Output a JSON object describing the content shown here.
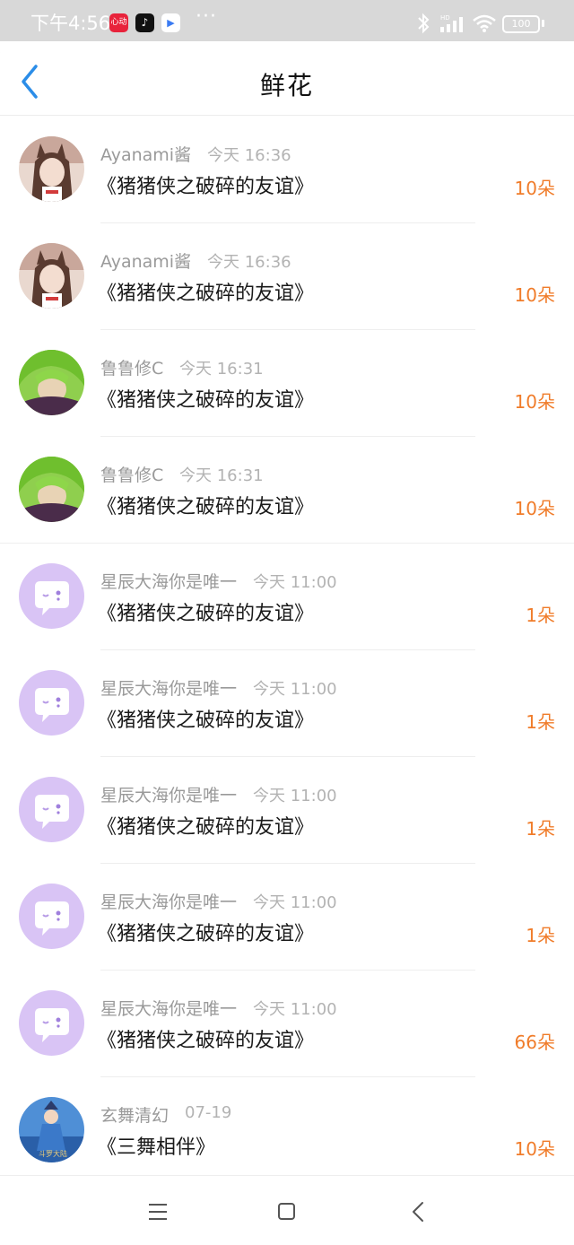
{
  "status_bar": {
    "time": "下午4:56",
    "apps": [
      {
        "icon": "red-app-icon",
        "label": "心动",
        "color": "#e8233b"
      },
      {
        "icon": "tiktok-icon",
        "label": "♪",
        "color": "#111111"
      },
      {
        "icon": "play-store-icon",
        "label": "▶",
        "color": "#ffffff"
      }
    ],
    "more": "···",
    "battery": "100"
  },
  "header": {
    "title": "鲜花",
    "back_icon": "chevron-left-icon",
    "accent_color": "#2b8de8"
  },
  "list": [
    {
      "user": "Ayanami酱",
      "time": "今天 16:36",
      "work": "《猪猪侠之破碎的友谊》",
      "count": "10朵",
      "avatar": "anime-girl-avatar"
    },
    {
      "user": "Ayanami酱",
      "time": "今天 16:36",
      "work": "《猪猪侠之破碎的友谊》",
      "count": "10朵",
      "avatar": "anime-girl-avatar"
    },
    {
      "user": "鲁鲁修C",
      "time": "今天 16:31",
      "work": "《猪猪侠之破碎的友谊》",
      "count": "10朵",
      "avatar": "green-hair-avatar"
    },
    {
      "user": "鲁鲁修C",
      "time": "今天 16:31",
      "work": "《猪猪侠之破碎的友谊》",
      "count": "10朵",
      "avatar": "green-hair-avatar"
    },
    {
      "user": "星辰大海你是唯一",
      "time": "今天 11:00",
      "work": "《猪猪侠之破碎的友谊》",
      "count": "1朵",
      "avatar": "default-chat-avatar"
    },
    {
      "user": "星辰大海你是唯一",
      "time": "今天 11:00",
      "work": "《猪猪侠之破碎的友谊》",
      "count": "1朵",
      "avatar": "default-chat-avatar"
    },
    {
      "user": "星辰大海你是唯一",
      "time": "今天 11:00",
      "work": "《猪猪侠之破碎的友谊》",
      "count": "1朵",
      "avatar": "default-chat-avatar"
    },
    {
      "user": "星辰大海你是唯一",
      "time": "今天 11:00",
      "work": "《猪猪侠之破碎的友谊》",
      "count": "1朵",
      "avatar": "default-chat-avatar"
    },
    {
      "user": "星辰大海你是唯一",
      "time": "今天 11:00",
      "work": "《猪猪侠之破碎的友谊》",
      "count": "66朵",
      "avatar": "default-chat-avatar"
    },
    {
      "user": "玄舞清幻",
      "time": "07-19",
      "work": "《三舞相伴》",
      "count": "10朵",
      "avatar": "blue-character-avatar"
    }
  ],
  "colors": {
    "count": "#f07c2a",
    "username": "#9a9a9a",
    "default_avatar": "#d9c4f5"
  },
  "nav_bar": {
    "menu_icon": "menu-icon",
    "home_icon": "home-square-icon",
    "back_icon": "back-triangle-icon"
  }
}
